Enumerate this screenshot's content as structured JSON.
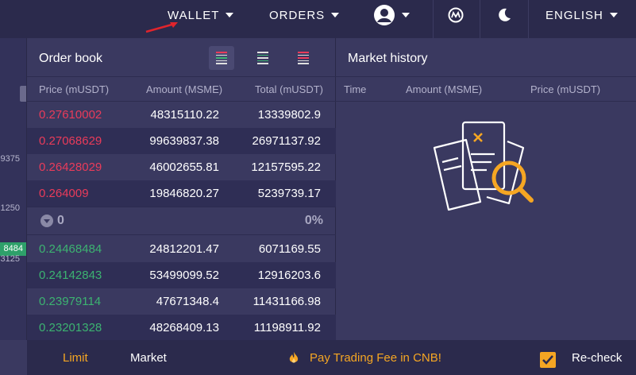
{
  "nav": {
    "wallet": "WALLET",
    "orders": "ORDERS",
    "language": "ENGLISH"
  },
  "left_strip": {
    "values": [
      "9375",
      "1250",
      "8484",
      "3125"
    ]
  },
  "order_book": {
    "title": "Order book",
    "columns": [
      "Price (mUSDT)",
      "Amount (MSME)",
      "Total (mUSDT)"
    ],
    "asks": [
      {
        "price": "0.27610002",
        "amount": "48315110.22",
        "total": "13339802.9"
      },
      {
        "price": "0.27068629",
        "amount": "99639837.38",
        "total": "26971137.92"
      },
      {
        "price": "0.26428029",
        "amount": "46002655.81",
        "total": "12157595.22"
      },
      {
        "price": "0.264009",
        "amount": "19846820.27",
        "total": "5239739.17"
      }
    ],
    "last_price": "0",
    "change": "0%",
    "bids": [
      {
        "price": "0.24468484",
        "amount": "24812201.47",
        "total": "6071169.55"
      },
      {
        "price": "0.24142843",
        "amount": "53499099.52",
        "total": "12916203.6"
      },
      {
        "price": "0.23979114",
        "amount": "47671348.4",
        "total": "11431166.98"
      },
      {
        "price": "0.23201328",
        "amount": "48268409.13",
        "total": "11198911.92"
      }
    ]
  },
  "market_history": {
    "title": "Market history",
    "columns": [
      "Time",
      "Amount (MSME)",
      "Price (mUSDT)"
    ]
  },
  "bottom": {
    "limit": "Limit",
    "market": "Market",
    "promo": "Pay Trading Fee in CNB!",
    "recheck": "Re-check"
  },
  "colors": {
    "ask": "#ea3b5a",
    "bid": "#3cb371",
    "accent": "#f5a623"
  }
}
